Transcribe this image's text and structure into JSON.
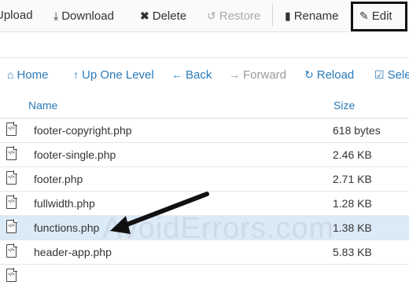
{
  "toolbar": {
    "upload": "Upload",
    "download": "Download",
    "delete": "Delete",
    "restore": "Restore",
    "rename": "Rename",
    "edit": "Edit"
  },
  "nav": {
    "home": "Home",
    "up_one_level": "Up One Level",
    "back": "Back",
    "forward": "Forward",
    "reload": "Reload",
    "select_all": "Sele"
  },
  "table": {
    "columns": [
      "Name",
      "Size"
    ],
    "rows": [
      {
        "name": "footer-copyright.php",
        "size": "618 bytes"
      },
      {
        "name": "footer-single.php",
        "size": "2.46 KB"
      },
      {
        "name": "footer.php",
        "size": "2.71 KB"
      },
      {
        "name": "fullwidth.php",
        "size": "1.28 KB"
      },
      {
        "name": "functions.php",
        "size": "1.38 KB"
      },
      {
        "name": "header-app.php",
        "size": "5.83 KB"
      }
    ]
  },
  "watermark": "AvoidErrors.com",
  "colors": {
    "link": "#2a7ab8",
    "selected_row": "#dbeaf7"
  }
}
